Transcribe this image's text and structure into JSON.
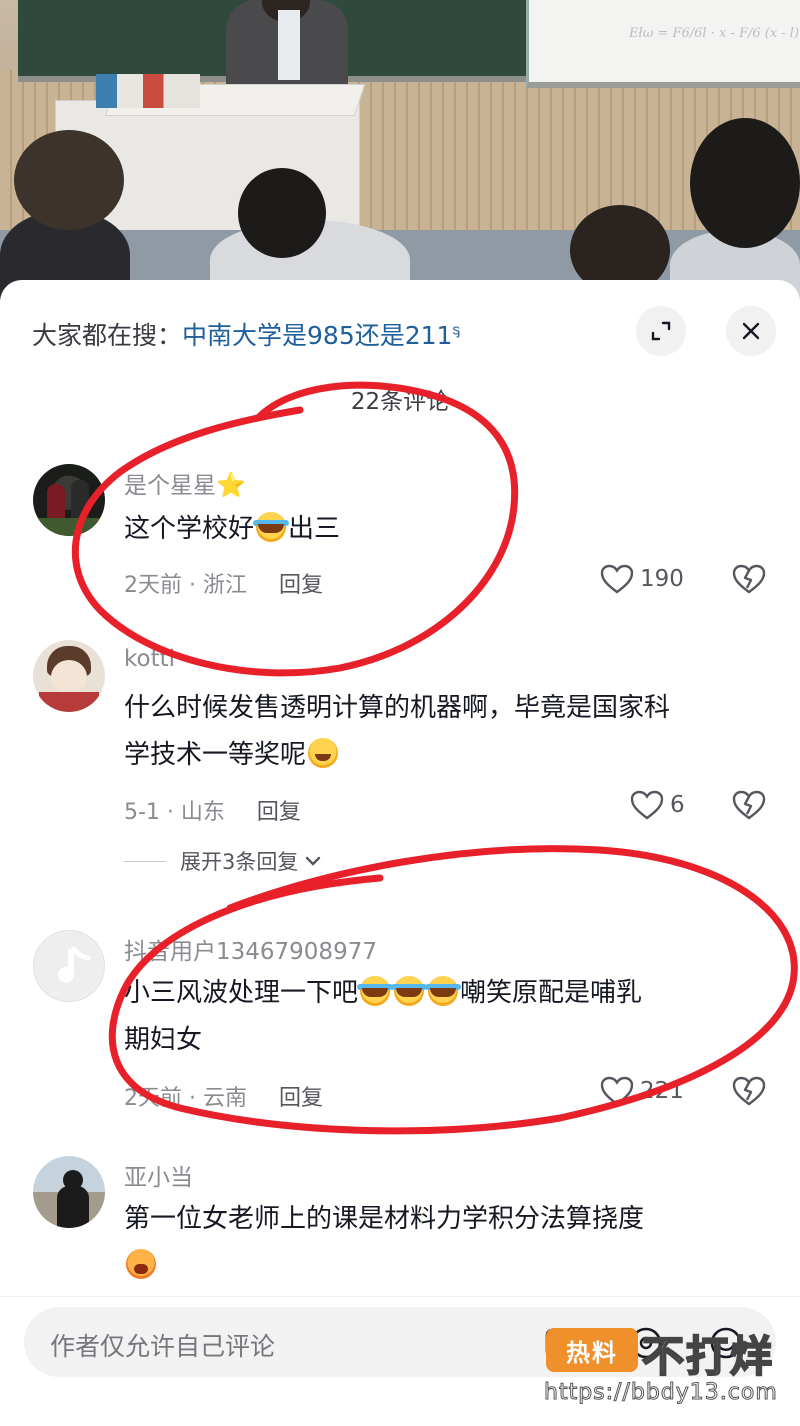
{
  "search_hint": {
    "prefix": "大家都在搜：",
    "keyword": "中南大学是985还是211"
  },
  "comment_count_label": "22条评论",
  "comments": [
    {
      "username": "是个星星",
      "text_before": "这个学校好",
      "text_after": "出三",
      "time_location": "2天前 · 浙江",
      "reply_label": "回复",
      "likes": "190"
    },
    {
      "username": "kotti",
      "text_line1": "什么时候发售透明计算的机器啊，毕竟是国家科",
      "text_line2": "学技术一等奖呢",
      "time_location": "5-1 · 山东",
      "reply_label": "回复",
      "likes": "6",
      "expand_replies": "展开3条回复"
    },
    {
      "username": "抖音用户13467908977",
      "text_before": "小三风波处理一下吧",
      "text_after": "嘲笑原配是哺乳",
      "text_line2": "期妇女",
      "time_location": "2天前 · 云南",
      "reply_label": "回复",
      "likes": "221"
    },
    {
      "username": "亚小当",
      "text": "第一位女老师上的课是材料力学积分法算挠度"
    }
  ],
  "input": {
    "placeholder": "作者仅允许自己评论"
  },
  "watermark": {
    "badge": "热料",
    "text": "不打烊",
    "url": "https://bbdy13.com"
  },
  "board_formula": "Ełω = F6/6l · x  -  F/6  (x - l)",
  "colors": {
    "link_blue": "#1f5f9c",
    "annotation_red": "#e8202a",
    "secondary_text": "#8a8b91"
  },
  "icons": [
    "expand-icon",
    "close-icon",
    "heart-icon",
    "broken-heart-icon",
    "chevron-down-icon",
    "search-hint-icon",
    "image-icon",
    "at-icon",
    "emoji-icon",
    "star-icon"
  ]
}
